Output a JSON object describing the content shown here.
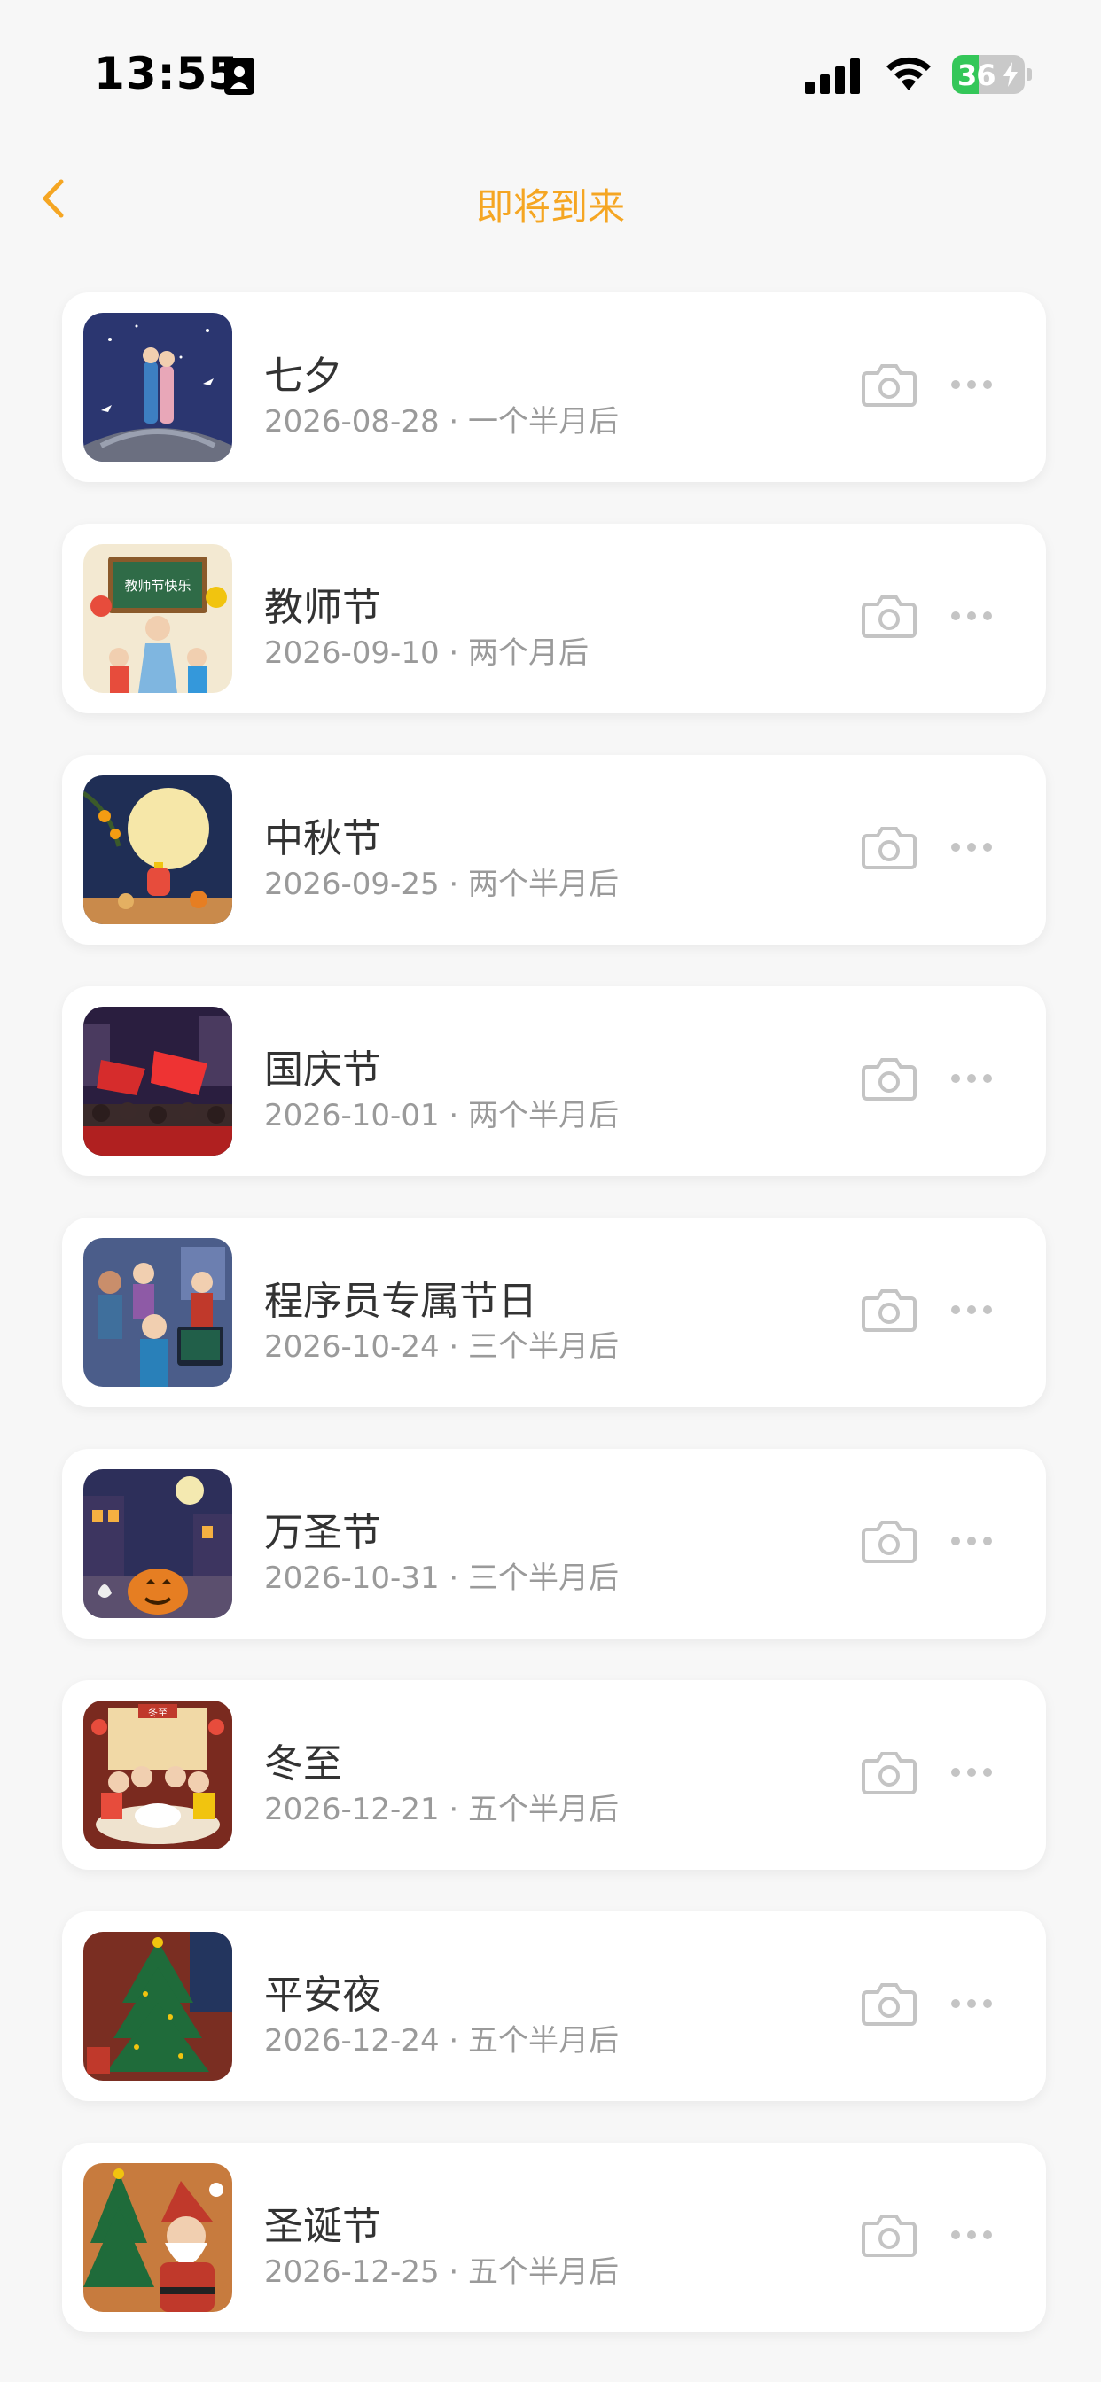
{
  "status_bar": {
    "time": "13:55",
    "battery_level": "36",
    "battery_percent": 36,
    "icons": [
      "id-card-icon",
      "cellular-signal-icon",
      "wifi-icon",
      "battery-charging-icon"
    ]
  },
  "nav": {
    "back_icon": "chevron-left-icon",
    "title": "即将到来"
  },
  "colors": {
    "accent": "#f5a623",
    "battery_green": "#34c759",
    "title_text": "#333333",
    "subtitle_text": "#9a9a9a",
    "icon_gray": "#c4c4c4"
  },
  "events": [
    {
      "name": "七夕",
      "date": "2026-08-28",
      "relative": "一个半月后",
      "image": "qixi-couple-illustration"
    },
    {
      "name": "教师节",
      "date": "2026-09-10",
      "relative": "两个月后",
      "image": "teachers-day-illustration",
      "image_text": "教师节快乐"
    },
    {
      "name": "中秋节",
      "date": "2026-09-25",
      "relative": "两个半月后",
      "image": "mid-autumn-moon-illustration"
    },
    {
      "name": "国庆节",
      "date": "2026-10-01",
      "relative": "两个半月后",
      "image": "national-day-flags-illustration"
    },
    {
      "name": "程序员专属节日",
      "date": "2026-10-24",
      "relative": "三个半月后",
      "image": "programmers-day-illustration"
    },
    {
      "name": "万圣节",
      "date": "2026-10-31",
      "relative": "三个半月后",
      "image": "halloween-pumpkin-illustration"
    },
    {
      "name": "冬至",
      "date": "2026-12-21",
      "relative": "五个半月后",
      "image": "winter-solstice-dumplings-illustration",
      "image_text": "冬至"
    },
    {
      "name": "平安夜",
      "date": "2026-12-24",
      "relative": "五个半月后",
      "image": "christmas-eve-tree-illustration"
    },
    {
      "name": "圣诞节",
      "date": "2026-12-25",
      "relative": "五个半月后",
      "image": "christmas-santa-illustration"
    }
  ],
  "row_actions": {
    "camera_icon": "camera-icon",
    "more_icon": "more-dots-icon"
  }
}
